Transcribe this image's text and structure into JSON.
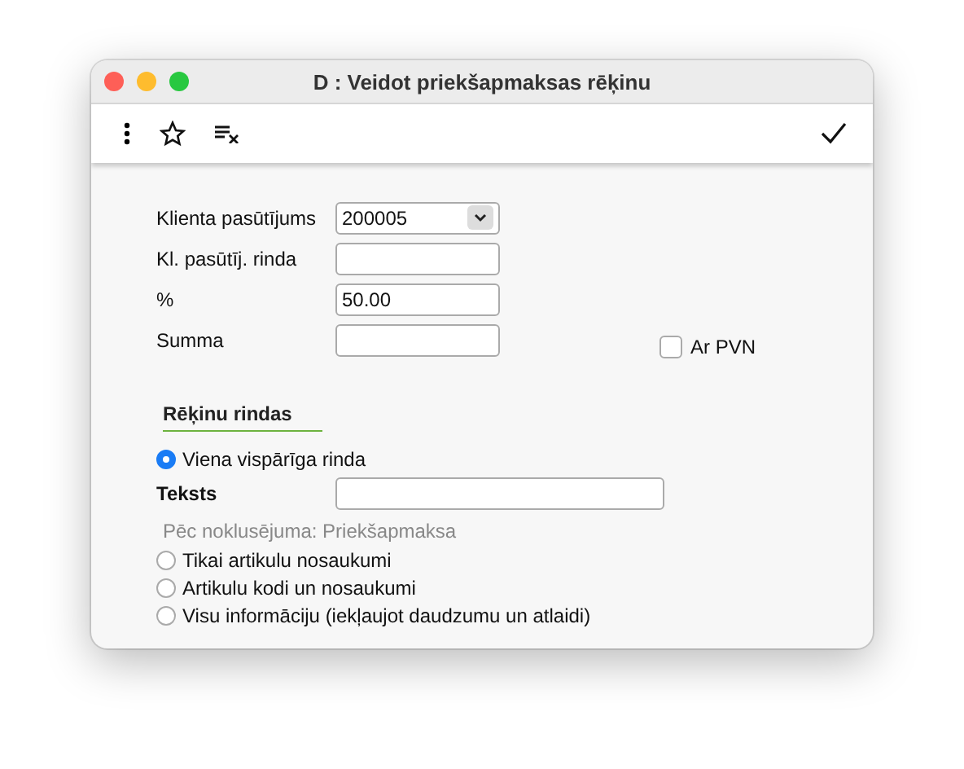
{
  "window": {
    "title": "D : Veidot priekšapmaksas rēķinu"
  },
  "toolbar": {
    "items": [
      {
        "kind": "more"
      },
      {
        "kind": "star"
      },
      {
        "kind": "clear"
      }
    ],
    "confirm": {
      "kind": "check"
    }
  },
  "form": {
    "fields": [
      {
        "label": "Klienta pasūtījums",
        "value": "200005",
        "kind": "select"
      },
      {
        "label": "Kl. pasūtīj. rinda",
        "kind": "text"
      },
      {
        "label": "%",
        "value": "50.00",
        "kind": "text"
      },
      {
        "label": "Summa",
        "kind": "text"
      }
    ],
    "vat_checkbox": {
      "label": "Ar PVN",
      "checked": false
    }
  },
  "invoice_lines": {
    "heading": "Rēķinu rindas",
    "options": [
      {
        "label": "Viena vispārīga rinda",
        "selected": true
      },
      {
        "label": "Tikai artikulu nosaukumi",
        "selected": false
      },
      {
        "label": "Artikulu kodi un nosaukumi",
        "selected": false
      },
      {
        "label": "Visu informāciju (iekļaujot daudzumu un atlaidi)",
        "selected": false
      }
    ],
    "text_field": {
      "label": "Teksts"
    },
    "hint": "Pēc noklusējuma: Priekšapmaksa"
  }
}
